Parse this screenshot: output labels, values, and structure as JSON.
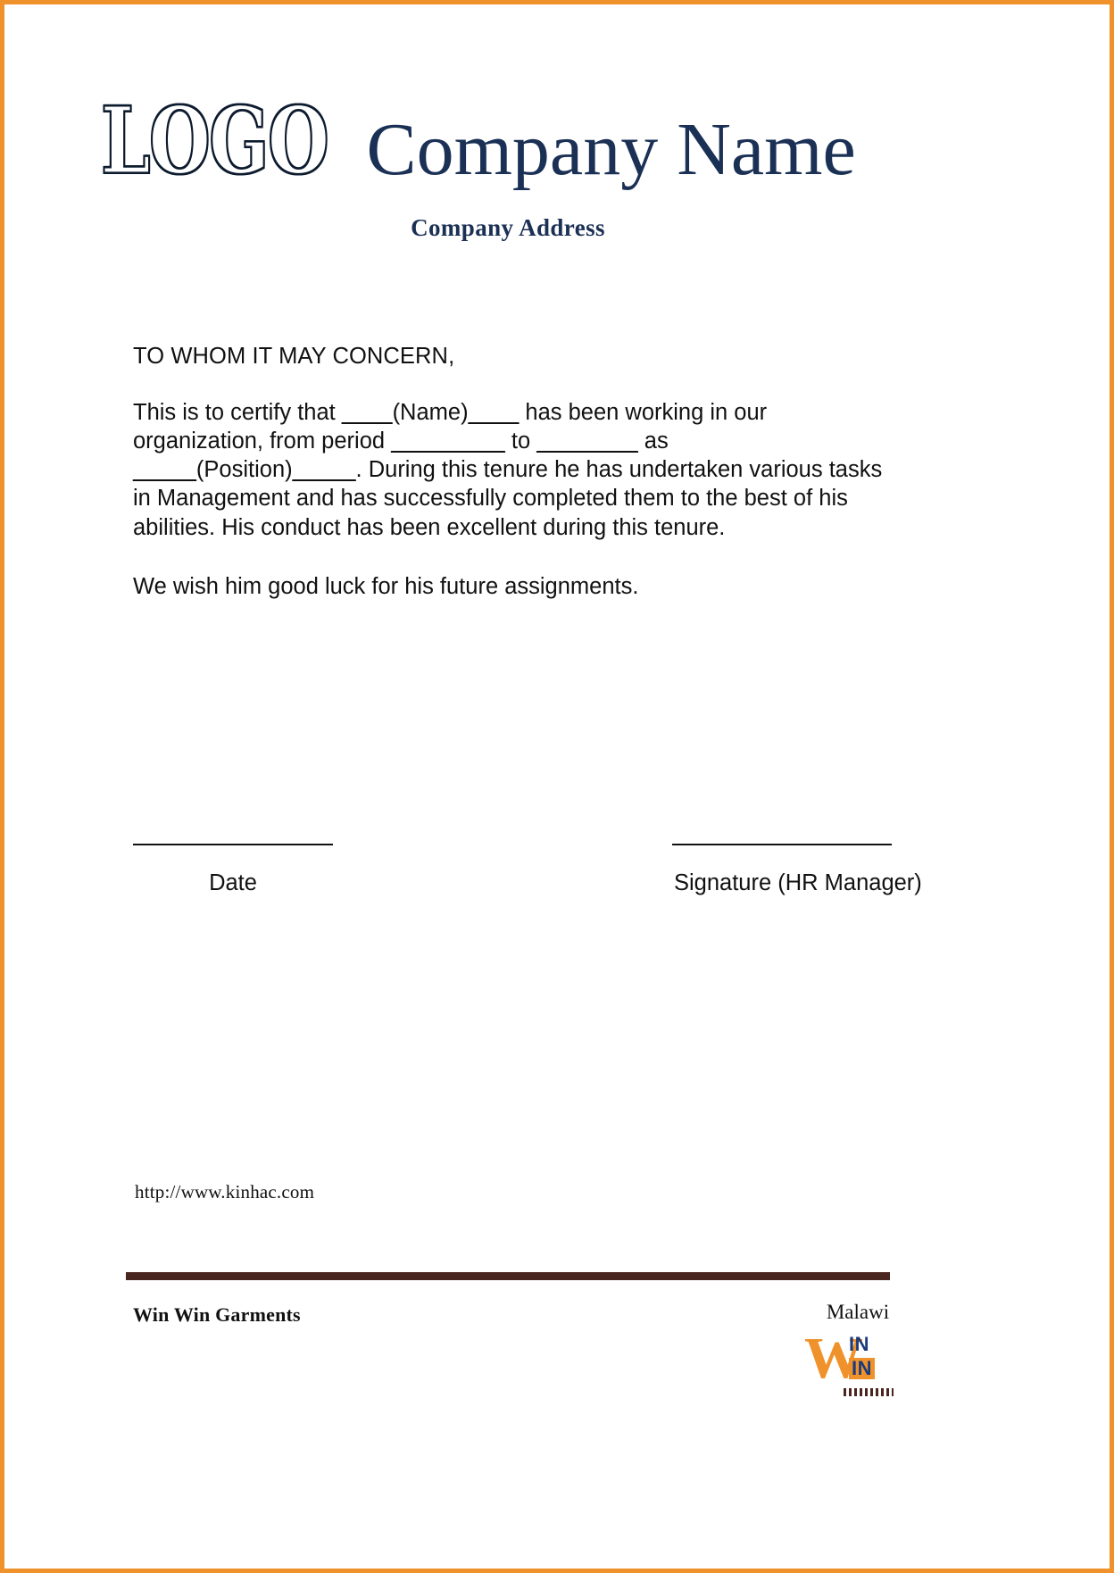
{
  "page": {
    "border_color": "#f0922b",
    "background": "#ffffff"
  },
  "header": {
    "logo_text": "LOGO",
    "company_name": "Company Name",
    "company_address": "Company Address",
    "brand_color": "#1b3055"
  },
  "letter": {
    "salutation": "TO WHOM IT MAY CONCERN,",
    "paragraph_1": {
      "segment_1": "This is to certify that ",
      "blank_1": "____",
      "placeholder_name": "(Name)",
      "blank_2": "____",
      "segment_2": " has been working in our organization, from period ",
      "blank_3": "_________",
      "segment_3": " to ",
      "blank_4": "________",
      "segment_4": " as ",
      "blank_5": "_____",
      "placeholder_position": "(Position)",
      "blank_6": "_____",
      "segment_5": ". During this tenure he has undertaken various tasks in Management and has successfully completed them to the best of his abilities. His conduct has been excellent during this tenure."
    },
    "paragraph_2": "We wish him good luck for his future assignments."
  },
  "signatures": {
    "date_label": "Date",
    "hr_label": "Signature (HR Manager)"
  },
  "website": {
    "url": "http://www.kinhac.com"
  },
  "footer": {
    "rule_color": "#4a2621",
    "company": "Win Win Garments",
    "country": "Malawi",
    "brand_mark": {
      "w_letter": "W",
      "in_top": "IN",
      "in_bottom": "IN",
      "accent_color": "#f0922b",
      "text_color": "#1b3b7a"
    }
  }
}
